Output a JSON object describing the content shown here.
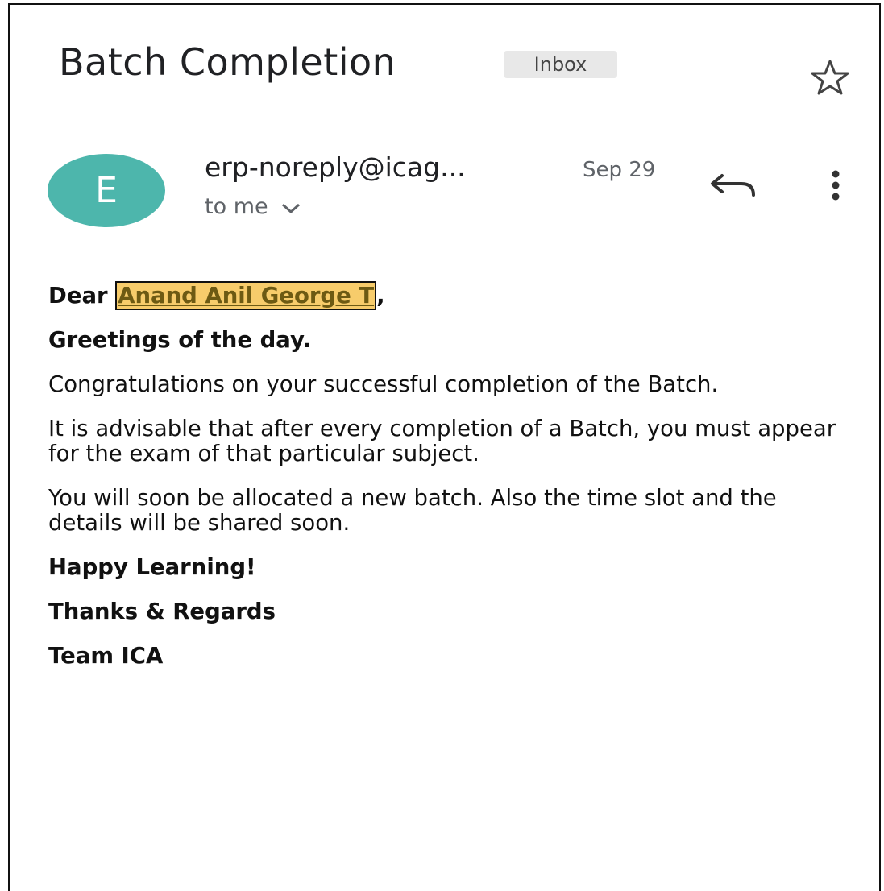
{
  "email": {
    "subject": "Batch Completion",
    "label": "Inbox",
    "sender_initial": "E",
    "sender": "erp-noreply@icag...",
    "date": "Sep 29",
    "recipient": "to me"
  },
  "icons": {
    "star": "star-outline-icon",
    "reply": "reply-arrow-icon",
    "more": "vertical-dots-icon",
    "expand": "chevron-down-icon"
  },
  "colors": {
    "avatar": "#4db6ac",
    "highlight": "#f7cc6b"
  },
  "message": {
    "salutation": "Dear",
    "recipient_name": "Anand Anil George T",
    "salutation_end": ",",
    "greeting": "Greetings of the day.",
    "para1": "Congratulations on your successful completion of the Batch.",
    "para2": "It is advisable that after every completion of a Batch, you must appear for the exam of that particular subject.",
    "para3": "You will soon be allocated a new batch. Also the time slot and the details will be shared soon.",
    "closing1": "Happy Learning!",
    "closing2": "Thanks & Regards",
    "signature": "Team ICA"
  }
}
